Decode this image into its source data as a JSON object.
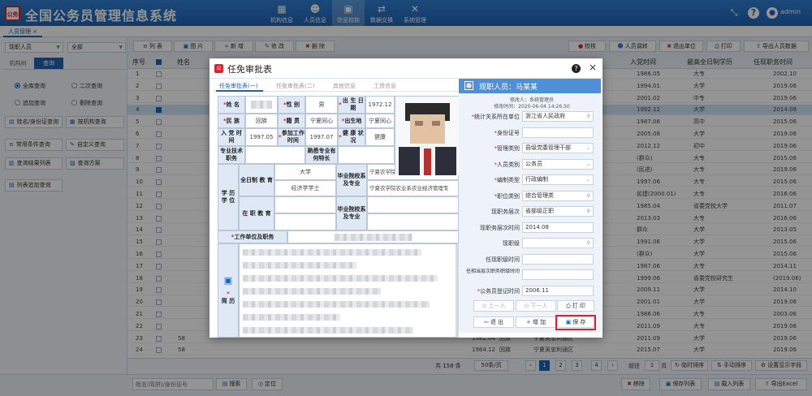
{
  "app": {
    "logo": "公务",
    "title": "全国公务员管理信息系统"
  },
  "nav": [
    {
      "label": "机构信息",
      "icon": "building-icon"
    },
    {
      "label": "人员信息",
      "icon": "person-icon"
    },
    {
      "label": "信息校核",
      "icon": "check-icon"
    },
    {
      "label": "数据交换",
      "icon": "exchange-icon"
    },
    {
      "label": "系统管理",
      "icon": "tools-icon"
    }
  ],
  "header_right": {
    "user": "admin",
    "avatar_glyph": "●",
    "help": "?"
  },
  "tab": {
    "label": "人员管理",
    "close": "×"
  },
  "left": {
    "select1": "现职人员",
    "select2": "全部",
    "tabs": [
      "机构树",
      "查询"
    ],
    "radios": [
      "全库查询",
      "二次查询",
      "追加查询",
      "剔除查询"
    ],
    "buttons": [
      "姓名/身份证查询",
      "按机构查询",
      "常用条件查询",
      "自定义查询",
      "查询结果列表",
      "查询方案",
      "列表追加查询"
    ]
  },
  "toolbar": {
    "left": [
      "列 表",
      "图 片",
      "新 增",
      "修 改",
      "删 除"
    ],
    "right": [
      "校核",
      "人员调转",
      "退出单位",
      "打印",
      "导出人员数据"
    ]
  },
  "grid": {
    "headers": [
      "序号",
      "姓名",
      "入党时间",
      "最高全日制学历",
      "任现职务时间"
    ],
    "rows": [
      {
        "n": "1",
        "party": "1986.05",
        "edu": "大专",
        "time": "2002.10",
        "gender": "",
        "place": ""
      },
      {
        "n": "2",
        "party": "1994.01",
        "edu": "大学",
        "time": "2019.06",
        "gender": "",
        "place": ""
      },
      {
        "n": "3",
        "party": "2001.02",
        "edu": "中专",
        "time": "2019.06",
        "gender": "",
        "place": ""
      },
      {
        "n": "4",
        "party": "1992.12",
        "edu": "大学",
        "time": "2014.08",
        "gender": "",
        "place": ""
      },
      {
        "n": "5",
        "party": "1987.06",
        "edu": "高中",
        "time": "2015.06",
        "gender": "",
        "place": ""
      },
      {
        "n": "6",
        "party": "2005.08",
        "edu": "大学",
        "time": "2019.06",
        "gender": "",
        "place": ""
      },
      {
        "n": "7",
        "party": "2012.12",
        "edu": "初中",
        "time": "2019.06",
        "gender": "",
        "place": ""
      },
      {
        "n": "8",
        "party": "(群众)",
        "edu": "大专",
        "time": "2015.06",
        "gender": "",
        "place": ""
      },
      {
        "n": "9",
        "party": "(民进)",
        "edu": "大专",
        "time": "2019.06",
        "gender": "",
        "place": ""
      },
      {
        "n": "10",
        "party": "1997.06",
        "edu": "大专",
        "time": "2015.06",
        "gender": "",
        "place": ""
      },
      {
        "n": "11",
        "party": "民建(2000.01)",
        "edu": "大专",
        "time": "2016.06",
        "gender": "",
        "place": ""
      },
      {
        "n": "12",
        "party": "1985.04",
        "edu": "省委党校大学",
        "time": "2011.07",
        "gender": "",
        "place": ""
      },
      {
        "n": "13",
        "party": "2013.03",
        "edu": "大专",
        "time": "2016.06",
        "gender": "",
        "place": ""
      },
      {
        "n": "14",
        "party": "群众",
        "edu": "大学",
        "time": "2013.05",
        "gender": "",
        "place": ""
      },
      {
        "n": "15",
        "party": "1991.06",
        "edu": "大学",
        "time": "2015.06",
        "gender": "",
        "place": ""
      },
      {
        "n": "16",
        "party": "(群众)",
        "edu": "大学",
        "time": "2015.06",
        "gender": "",
        "place": ""
      },
      {
        "n": "17",
        "party": "1987.06",
        "edu": "大专",
        "time": "2014.11",
        "gender": "",
        "place": ""
      },
      {
        "n": "18",
        "party": "1999.06",
        "edu": "省委党校研究生",
        "time": "(2019.06)",
        "gender": "",
        "place": ""
      },
      {
        "n": "19",
        "party": "2009.11",
        "edu": "大学",
        "time": "2014.10",
        "gender": "",
        "place": ""
      },
      {
        "n": "20",
        "party": "2001.01",
        "edu": "大学",
        "time": "2019.06",
        "gender": "",
        "place": ""
      },
      {
        "n": "21",
        "party": "1986.06",
        "edu": "大专",
        "time": "2003.06",
        "gender": "",
        "place": ""
      },
      {
        "n": "22",
        "party": "2011.09",
        "edu": "大专",
        "time": "2019.06",
        "gender": "",
        "place": ""
      },
      {
        "n": "23",
        "party": "2011.09",
        "edu": "大学",
        "time": "2019.06",
        "gender": "回族",
        "place": "宁夏吴忠利通区",
        "birth": "1982.04",
        "pre": "58"
      },
      {
        "n": "24",
        "party": "2015.07",
        "edu": "大学",
        "time": "2019.06",
        "gender": "回族",
        "place": "宁夏吴忠利通区",
        "birth": "1984.12",
        "pre": "58"
      }
    ]
  },
  "pager": {
    "total": "共 158 条",
    "size": "50条/页",
    "pages": [
      "1",
      "2",
      "3",
      "4"
    ],
    "prev": "‹",
    "next": "›",
    "goto_label": "前往",
    "goto_value": "1",
    "page_unit": "页",
    "buttons": [
      "临时排序",
      "手动排序",
      "设置显示字段"
    ]
  },
  "bottom": {
    "search_placeholder": "姓名(简拼)/身份证号",
    "search": "搜索",
    "locate": "定位",
    "right": [
      "移除",
      "保存列表",
      "载入列表",
      "导出Excel"
    ]
  },
  "modal": {
    "logo": "公",
    "title": "任免审批表",
    "help": "?",
    "close": "×",
    "tabs": [
      "任免审批表(一)",
      "任免审批表(二)",
      "其他信息",
      "工资信息"
    ],
    "form": {
      "name_l": "姓 名",
      "sex_l": "性 别",
      "sex_v": "男",
      "birth_l": "出 生 日 期",
      "birth_v": "1972.12",
      "nation_l": "民 族",
      "nation_v": "回族",
      "native_l": "籍 贯",
      "native_v": "宁夏同心",
      "bplace_l": "出生地",
      "bplace_v": "宁夏同心",
      "party_l": "入 党 时 间",
      "party_v": "1997.05",
      "work_l": "参加工作时间",
      "work_v": "1997.07",
      "health_l": "健 康 状 况",
      "health_v": "健康",
      "title_l": "专业技术职务",
      "specialty_l": "熟悉专业有何特长",
      "edu_l": "学 历 学 位",
      "ft_l": "全日制 教 育",
      "ft_v1": "大学",
      "ft_v2": "经济学学士",
      "sch_l": "毕业院校系及专业",
      "sch_v1": "宁夏农学院农业系农业经济管理专",
      "sch_v2": "宁夏农学院农业系农业经济管理专",
      "ot_l": "在 职 教 育",
      "sch2_l": "毕业院校系及专业",
      "job_l": "工作单位及职务",
      "resume_l": "简 历"
    },
    "right": {
      "title": "现职人员：马某某",
      "modifier": "修改人：系统管理员",
      "modtime": "修改时间：2020-06-04 14:26:50",
      "fields": [
        {
          "label": "统计关系所在单位",
          "value": "浙江省人民政府",
          "req": true,
          "kind": "search"
        },
        {
          "label": "身份证号",
          "value": "",
          "req": true,
          "kind": "text"
        },
        {
          "label": "管理类别",
          "value": "县级党委管理干部",
          "req": true,
          "kind": "select"
        },
        {
          "label": "人员类别",
          "value": "公务员",
          "req": true,
          "kind": "select"
        },
        {
          "label": "编制类型",
          "value": "行政编制",
          "req": true,
          "kind": "select"
        },
        {
          "label": "职位类别",
          "value": "综合管理类",
          "req": true,
          "kind": "search"
        },
        {
          "label": "现职务层次",
          "value": "省部级正职",
          "req": false,
          "kind": "search"
        },
        {
          "label": "现职务层次时间",
          "value": "2014.08",
          "req": false,
          "kind": "text"
        },
        {
          "label": "现职级",
          "value": "",
          "req": false,
          "kind": "search"
        },
        {
          "label": "任现职级时间",
          "value": "",
          "req": false,
          "kind": "text"
        },
        {
          "label": "任相当层次职务职级时间",
          "value": "",
          "req": false,
          "kind": "text"
        },
        {
          "label": "公务员登记时间",
          "value": "2006.11",
          "req": true,
          "kind": "text"
        }
      ],
      "buttons": [
        "上一人",
        "下一人",
        "打 印",
        "退 出",
        "增 加",
        "保 存"
      ]
    }
  },
  "colors": {
    "primary": "#1f63b4",
    "header": "#2f7fd2",
    "danger": "#d9242f",
    "panel": "#4f8fd6"
  }
}
